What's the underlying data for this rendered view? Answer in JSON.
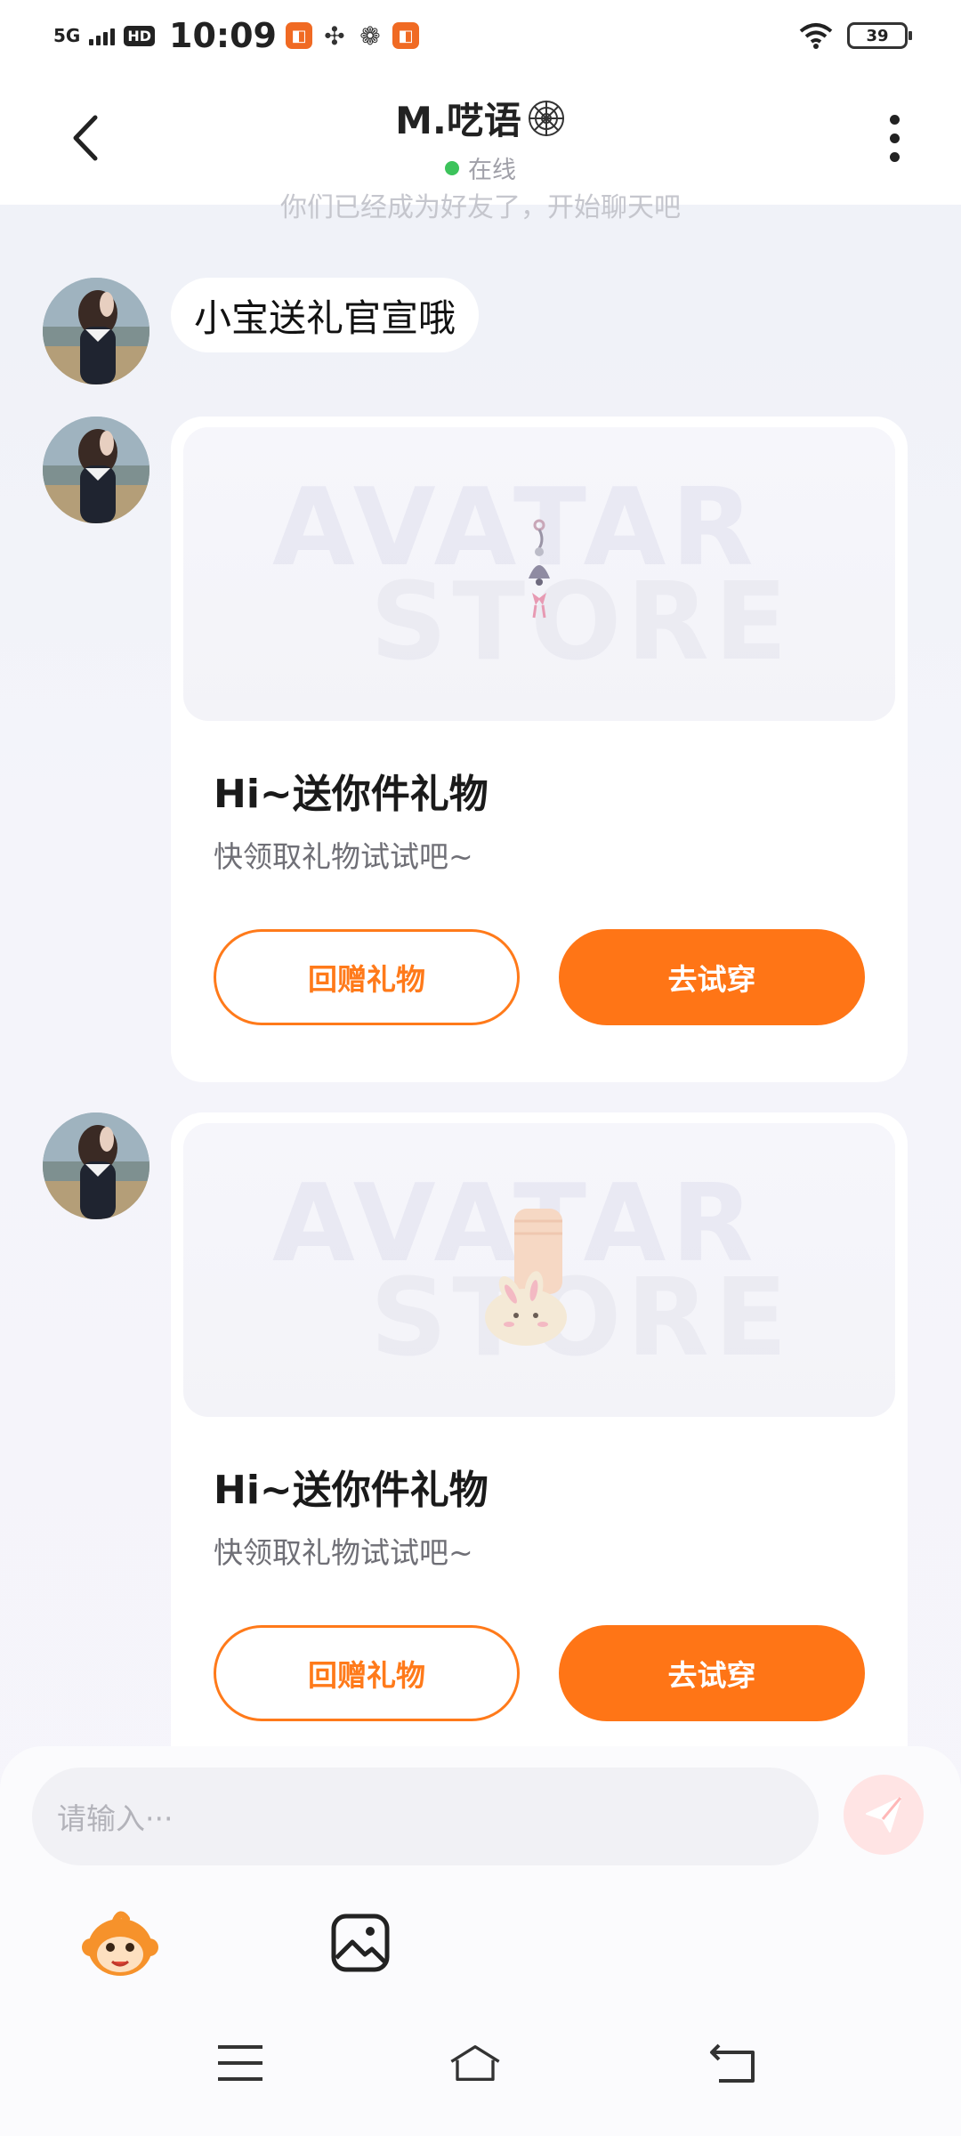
{
  "status_bar": {
    "network": "5G",
    "hd": "HD",
    "time": "10:09",
    "battery": "39"
  },
  "header": {
    "title": "M.呓语",
    "status": "在线"
  },
  "system_message": "你们已经成为好友了，开始聊天吧",
  "messages": {
    "text": "小宝送礼官宣哦",
    "cards": [
      {
        "watermark_top": "AVATAR",
        "watermark_bottom": "STORE",
        "title": "Hi~送你件礼物",
        "subtitle": "快领取礼物试试吧~",
        "return_gift": "回赠礼物",
        "try_on": "去试穿"
      },
      {
        "watermark_top": "AVATAR",
        "watermark_bottom": "STORE",
        "title": "Hi~送你件礼物",
        "subtitle": "快领取礼物试试吧~",
        "return_gift": "回赠礼物",
        "try_on": "去试穿"
      }
    ]
  },
  "input": {
    "placeholder": "请输入···"
  },
  "colors": {
    "accent": "#ff7516",
    "online": "#3cc35b"
  }
}
